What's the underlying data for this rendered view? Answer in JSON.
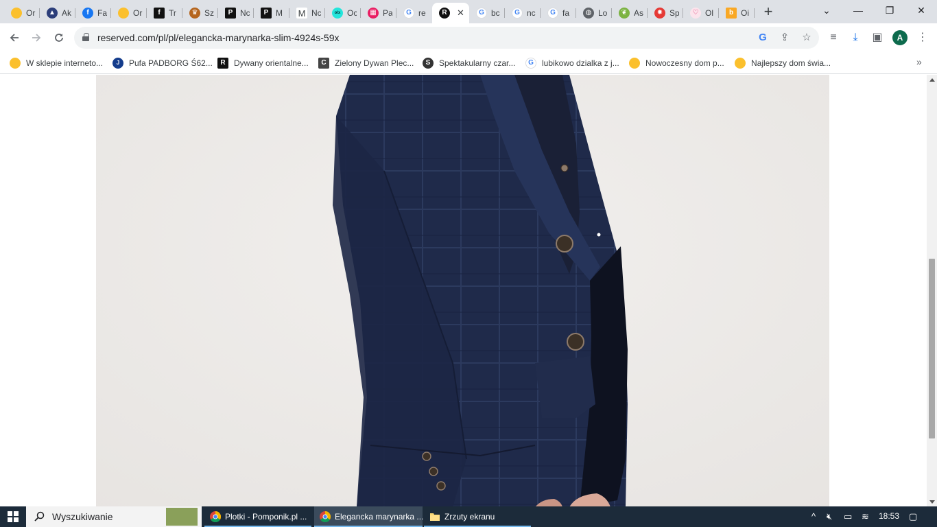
{
  "tabs": [
    {
      "title": "Or",
      "icon": "yellow-circle-icon",
      "color": "#fbc02d",
      "glyph": ""
    },
    {
      "title": "Ak",
      "icon": "mountain-icon",
      "color": "#2c3e7a",
      "glyph": "▲"
    },
    {
      "title": "Fa",
      "icon": "facebook-icon",
      "color": "#1877f2",
      "glyph": "f"
    },
    {
      "title": "Or",
      "icon": "yellow-circle-icon",
      "color": "#fbc02d",
      "glyph": ""
    },
    {
      "title": "Tr",
      "icon": "f-square-icon",
      "color": "#111111",
      "glyph": "f"
    },
    {
      "title": "Sz",
      "icon": "crown-icon",
      "color": "#b5651d",
      "glyph": "♛"
    },
    {
      "title": "Nc",
      "icon": "p-square-icon",
      "color": "#111111",
      "glyph": "P"
    },
    {
      "title": "M",
      "icon": "p-square-icon",
      "color": "#111111",
      "glyph": "P"
    },
    {
      "title": "Nc",
      "icon": "m-letter-icon",
      "color": "#ffffff",
      "glyph": "M"
    },
    {
      "title": "Oc",
      "icon": "olx-icon",
      "color": "#23e5db",
      "glyph": "olx"
    },
    {
      "title": "Pa",
      "icon": "grid-colors-icon",
      "color": "#e91e63",
      "glyph": "▦"
    },
    {
      "title": "re",
      "icon": "google-icon",
      "color": "#ffffff",
      "glyph": "G"
    },
    {
      "title": "",
      "icon": "reserved-logo-icon",
      "color": "#111111",
      "glyph": "R",
      "active": true
    },
    {
      "title": "bc",
      "icon": "google-icon",
      "color": "#ffffff",
      "glyph": "G"
    },
    {
      "title": "nc",
      "icon": "google-icon",
      "color": "#ffffff",
      "glyph": "G"
    },
    {
      "title": "fa",
      "icon": "google-icon",
      "color": "#ffffff",
      "glyph": "G"
    },
    {
      "title": "Lo",
      "icon": "globe-icon",
      "color": "#5f6368",
      "glyph": "◍"
    },
    {
      "title": "As",
      "icon": "leaf-icon",
      "color": "#7cb342",
      "glyph": "❦"
    },
    {
      "title": "Sp",
      "icon": "star-burst-icon",
      "color": "#e53935",
      "glyph": "✸"
    },
    {
      "title": "Ol",
      "icon": "heart-icon",
      "color": "#f8bbd0",
      "glyph": "♡"
    },
    {
      "title": "Oi",
      "icon": "orange-square-icon",
      "color": "#f9a825",
      "glyph": "b"
    }
  ],
  "window": {
    "minimize": "—",
    "maximize": "❐",
    "close": "✕",
    "tablist": "⌄",
    "newtab": "+"
  },
  "toolbar": {
    "url": "reserved.com/pl/pl/elegancka-marynarka-slim-4924s-59x",
    "profile_initial": "A"
  },
  "bookmarks": [
    {
      "label": "W sklepie interneto...",
      "icon": "yellow-circle-icon",
      "color": "#fbc02d",
      "glyph": ""
    },
    {
      "label": "Pufa PADBORG Ś62...",
      "icon": "jysk-icon",
      "color": "#143c8c",
      "glyph": "J"
    },
    {
      "label": "Dywany orientalne...",
      "icon": "r-square-icon",
      "color": "#111111",
      "glyph": "R"
    },
    {
      "label": "Zielony Dywan Plec...",
      "icon": "c-square-icon",
      "color": "#444444",
      "glyph": "C"
    },
    {
      "label": "Spektakularny czar...",
      "icon": "s-logo-icon",
      "color": "#333333",
      "glyph": "S"
    },
    {
      "label": "lubikowo dzialka z j...",
      "icon": "google-icon",
      "color": "#ffffff",
      "glyph": "G"
    },
    {
      "label": "Nowoczesny dom p...",
      "icon": "yellow-circle-icon",
      "color": "#fbc02d",
      "glyph": ""
    },
    {
      "label": "Najlepszy dom świa...",
      "icon": "yellow-circle-icon",
      "color": "#fbc02d",
      "glyph": ""
    }
  ],
  "product_image": {
    "alt": "Elegancka marynarka slim",
    "background": "#eeecea",
    "jacket_color": "#1f2a4a"
  },
  "taskbar": {
    "search_placeholder": "Wyszukiwanie",
    "items": [
      {
        "label": "Plotki - Pomponik.pl ...",
        "icon": "chrome-icon",
        "active": false
      },
      {
        "label": "Elegancka marynarka ...",
        "icon": "chrome-icon",
        "active": true
      },
      {
        "label": "Zrzuty ekranu",
        "icon": "folder-icon",
        "active": false
      }
    ],
    "time": "18:53"
  }
}
